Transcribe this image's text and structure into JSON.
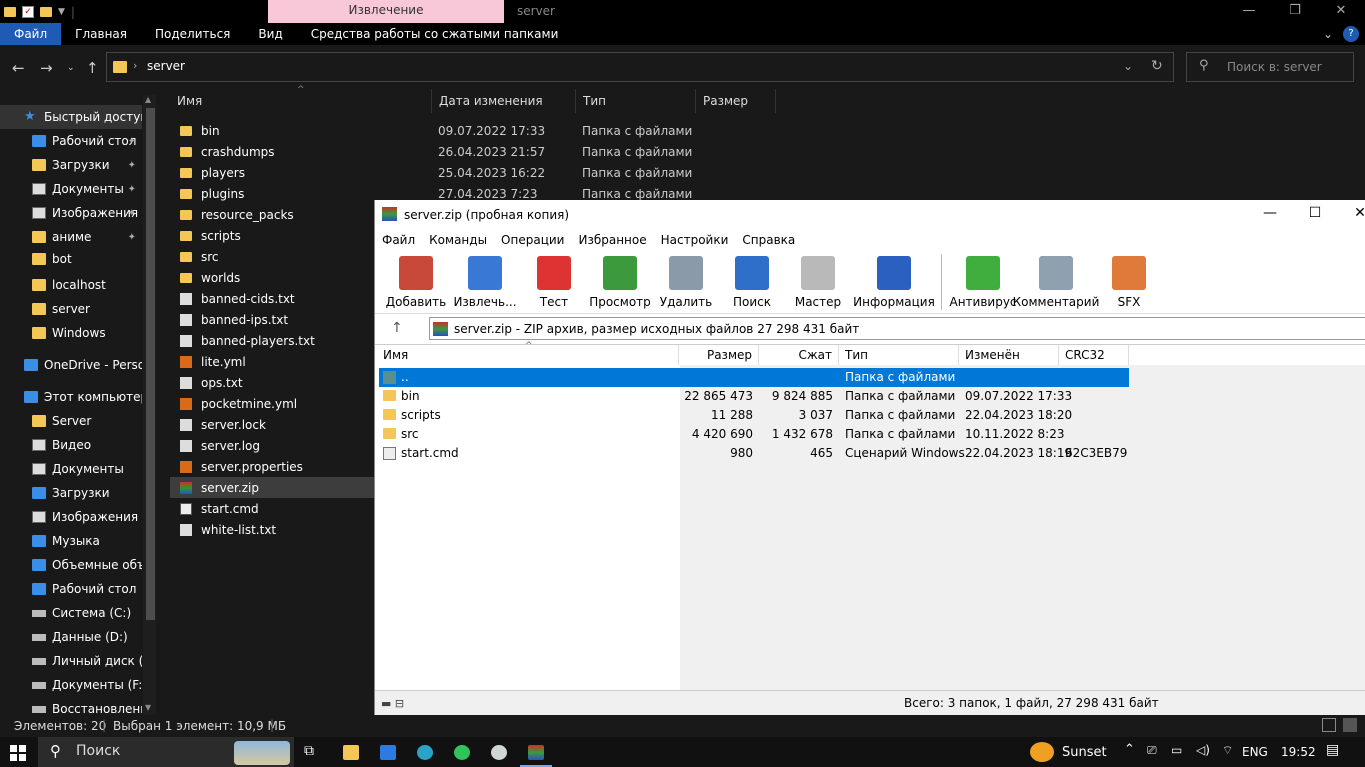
{
  "explorer": {
    "context_tab": "Извлечение",
    "window_title": "server",
    "ribbon_tabs": [
      "Файл",
      "Главная",
      "Поделиться",
      "Вид",
      "Средства работы со сжатыми папками"
    ],
    "address": "server",
    "search_placeholder": "Поиск в: server",
    "nav": [
      {
        "label": "Быстрый доступ",
        "icon": "star-icon",
        "pin": false
      },
      {
        "label": "Рабочий стол",
        "icon": "desktop-icon",
        "pin": true
      },
      {
        "label": "Загрузки",
        "icon": "folder-icon",
        "pin": true
      },
      {
        "label": "Документы",
        "icon": "documents-icon",
        "pin": true
      },
      {
        "label": "Изображения",
        "icon": "pictures-icon",
        "pin": true
      },
      {
        "label": "аниме",
        "icon": "folder-icon",
        "pin": true
      },
      {
        "label": "bot",
        "icon": "folder-icon",
        "pin": false
      },
      {
        "label": "localhost",
        "icon": "folder-icon",
        "pin": false
      },
      {
        "label": "server",
        "icon": "folder-icon",
        "pin": false
      },
      {
        "label": "Windows",
        "icon": "folder-icon",
        "pin": false
      },
      {
        "label": "OneDrive - Personal",
        "icon": "cloud-icon",
        "pin": false
      },
      {
        "label": "Этот компьютер",
        "icon": "computer-icon",
        "pin": false
      },
      {
        "label": "Server",
        "icon": "folder-icon",
        "pin": false
      },
      {
        "label": "Видео",
        "icon": "video-icon",
        "pin": false
      },
      {
        "label": "Документы",
        "icon": "documents-icon",
        "pin": false
      },
      {
        "label": "Загрузки",
        "icon": "download-icon",
        "pin": false
      },
      {
        "label": "Изображения",
        "icon": "pictures-icon",
        "pin": false
      },
      {
        "label": "Музыка",
        "icon": "music-icon",
        "pin": false
      },
      {
        "label": "Объемные объекты",
        "icon": "3d-objects-icon",
        "pin": false
      },
      {
        "label": "Рабочий стол",
        "icon": "desktop-icon",
        "pin": false
      },
      {
        "label": "Система (C:)",
        "icon": "drive-icon",
        "pin": false
      },
      {
        "label": "Данные (D:)",
        "icon": "drive-icon",
        "pin": false
      },
      {
        "label": "Личный диск (E:)",
        "icon": "drive-icon",
        "pin": false
      },
      {
        "label": "Документы (F:)",
        "icon": "drive-icon",
        "pin": false
      },
      {
        "label": "Восстановление",
        "icon": "drive-icon",
        "pin": false
      }
    ],
    "columns": [
      "Имя",
      "Дата изменения",
      "Тип",
      "Размер"
    ],
    "files": [
      {
        "name": "bin",
        "date": "09.07.2022 17:33",
        "type": "Папка с файлами",
        "icon": "fold"
      },
      {
        "name": "crashdumps",
        "date": "26.04.2023 21:57",
        "type": "Папка с файлами",
        "icon": "fold"
      },
      {
        "name": "players",
        "date": "25.04.2023 16:22",
        "type": "Папка с файлами",
        "icon": "fold"
      },
      {
        "name": "plugins",
        "date": "27.04.2023 7:23",
        "type": "Папка с файлами",
        "icon": "fold"
      },
      {
        "name": "resource_packs",
        "date": "",
        "type": "",
        "icon": "fold"
      },
      {
        "name": "scripts",
        "date": "",
        "type": "",
        "icon": "fold"
      },
      {
        "name": "src",
        "date": "",
        "type": "",
        "icon": "fold"
      },
      {
        "name": "worlds",
        "date": "",
        "type": "",
        "icon": "fold"
      },
      {
        "name": "banned-cids.txt",
        "date": "",
        "type": "",
        "icon": "doc"
      },
      {
        "name": "banned-ips.txt",
        "date": "",
        "type": "",
        "icon": "doc"
      },
      {
        "name": "banned-players.txt",
        "date": "",
        "type": "",
        "icon": "doc"
      },
      {
        "name": "lite.yml",
        "date": "",
        "type": "",
        "icon": "yml"
      },
      {
        "name": "ops.txt",
        "date": "",
        "type": "",
        "icon": "doc"
      },
      {
        "name": "pocketmine.yml",
        "date": "",
        "type": "",
        "icon": "yml"
      },
      {
        "name": "server.lock",
        "date": "",
        "type": "",
        "icon": "doc"
      },
      {
        "name": "server.log",
        "date": "",
        "type": "",
        "icon": "doc"
      },
      {
        "name": "server.properties",
        "date": "",
        "type": "",
        "icon": "yml"
      },
      {
        "name": "server.zip",
        "date": "",
        "type": "",
        "icon": "zip"
      },
      {
        "name": "start.cmd",
        "date": "",
        "type": "",
        "icon": "cmd"
      },
      {
        "name": "white-list.txt",
        "date": "",
        "type": "",
        "icon": "doc"
      }
    ],
    "selected_file": "server.zip",
    "status_count": "Элементов: 20",
    "status_selected": "Выбран 1 элемент: 10,9 МБ"
  },
  "winrar": {
    "title": "server.zip (пробная копия)",
    "menu": [
      "Файл",
      "Команды",
      "Операции",
      "Избранное",
      "Настройки",
      "Справка"
    ],
    "tools": [
      {
        "label": "Добавить",
        "icon": "add-archive-icon",
        "color": "#c8483a"
      },
      {
        "label": "Извлечь...",
        "icon": "extract-icon",
        "color": "#3a78d6"
      },
      {
        "label": "Тест",
        "icon": "test-icon",
        "color": "#d33"
      },
      {
        "label": "Просмотр",
        "icon": "view-book-icon",
        "color": "#3c9a3c"
      },
      {
        "label": "Удалить",
        "icon": "delete-icon",
        "color": "#8a9aa8"
      },
      {
        "label": "Поиск",
        "icon": "find-icon",
        "color": "#2f6fc9"
      },
      {
        "label": "Мастер",
        "icon": "wizard-icon",
        "color": "#b9b9b9"
      },
      {
        "label": "Информация",
        "icon": "info-icon",
        "color": "#2b5fc0"
      }
    ],
    "tools2": [
      {
        "label": "Антивирус",
        "icon": "antivirus-icon",
        "color": "#3fae3f"
      },
      {
        "label": "Комментарий",
        "icon": "comment-icon",
        "color": "#8fa0b0"
      },
      {
        "label": "SFX",
        "icon": "sfx-icon",
        "color": "#e07a3a"
      }
    ],
    "path_text": "server.zip - ZIP архив, размер исходных файлов 27 298 431 байт",
    "columns": [
      "Имя",
      "Размер",
      "Сжат",
      "Тип",
      "Изменён",
      "CRC32"
    ],
    "rows": [
      {
        "name": "..",
        "size": "",
        "packed": "",
        "type": "Папка с файлами",
        "modified": "",
        "crc": "",
        "icon": "up"
      },
      {
        "name": "bin",
        "size": "22 865 473",
        "packed": "9 824 885",
        "type": "Папка с файлами",
        "modified": "09.07.2022 17:33",
        "crc": "",
        "icon": "fold"
      },
      {
        "name": "scripts",
        "size": "11 288",
        "packed": "3 037",
        "type": "Папка с файлами",
        "modified": "22.04.2023 18:20",
        "crc": "",
        "icon": "fold"
      },
      {
        "name": "src",
        "size": "4 420 690",
        "packed": "1 432 678",
        "type": "Папка с файлами",
        "modified": "10.11.2022 8:23",
        "crc": "",
        "icon": "fold"
      },
      {
        "name": "start.cmd",
        "size": "980",
        "packed": "465",
        "type": "Сценарий Windows",
        "modified": "22.04.2023 18:19",
        "crc": "62C3EB79",
        "icon": "cmd"
      }
    ],
    "status": "Всего: 3 папок, 1 файл, 27 298 431 байт"
  },
  "taskbar": {
    "search_label": "Поиск",
    "weather": "Sunset",
    "lang": "ENG",
    "time": "19:52"
  }
}
